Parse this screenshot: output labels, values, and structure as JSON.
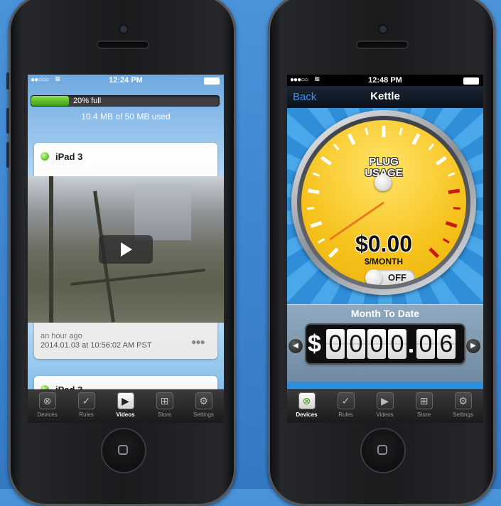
{
  "left_phone": {
    "status": {
      "signal": "●●○○○",
      "time": "12:24 PM"
    },
    "storage": {
      "percent": 20,
      "label": "20% full",
      "used_text": "10.4 MB of 50 MB used"
    },
    "cards": [
      {
        "title": "iPad 3",
        "relative_time": "an hour ago",
        "timestamp": "2014.01.03 at 10:56:02 AM PST"
      },
      {
        "title": "iPad 3"
      }
    ],
    "tabs": [
      {
        "label": "Devices",
        "icon": "devices-icon"
      },
      {
        "label": "Rules",
        "icon": "rules-icon"
      },
      {
        "label": "Videos",
        "icon": "videos-icon",
        "active": true
      },
      {
        "label": "Store",
        "icon": "store-icon"
      },
      {
        "label": "Settings",
        "icon": "settings-icon"
      }
    ]
  },
  "right_phone": {
    "status": {
      "signal": "●●●○○",
      "time": "12:48 PM"
    },
    "nav": {
      "back": "Back",
      "title": "Kettle"
    },
    "gauge": {
      "label_line1": "PLUG",
      "label_line2": "USAGE",
      "amount": "$0.00",
      "unit": "$/MONTH",
      "toggle": "OFF",
      "toggle_on": false
    },
    "month_to_date": {
      "title": "Month To Date",
      "currency": "$",
      "digits": [
        "0",
        "0",
        "0",
        "0",
        "0",
        "6"
      ],
      "value": "0000.06"
    },
    "tabs": [
      {
        "label": "Devices",
        "icon": "devices-icon",
        "active": true
      },
      {
        "label": "Rules",
        "icon": "rules-icon"
      },
      {
        "label": "Videos",
        "icon": "videos-icon"
      },
      {
        "label": "Store",
        "icon": "store-icon"
      },
      {
        "label": "Settings",
        "icon": "settings-icon"
      }
    ]
  },
  "colors": {
    "accent_blue": "#3f8ff2",
    "progress_green": "#5cc52a",
    "gauge_yellow": "#f6c21c"
  }
}
